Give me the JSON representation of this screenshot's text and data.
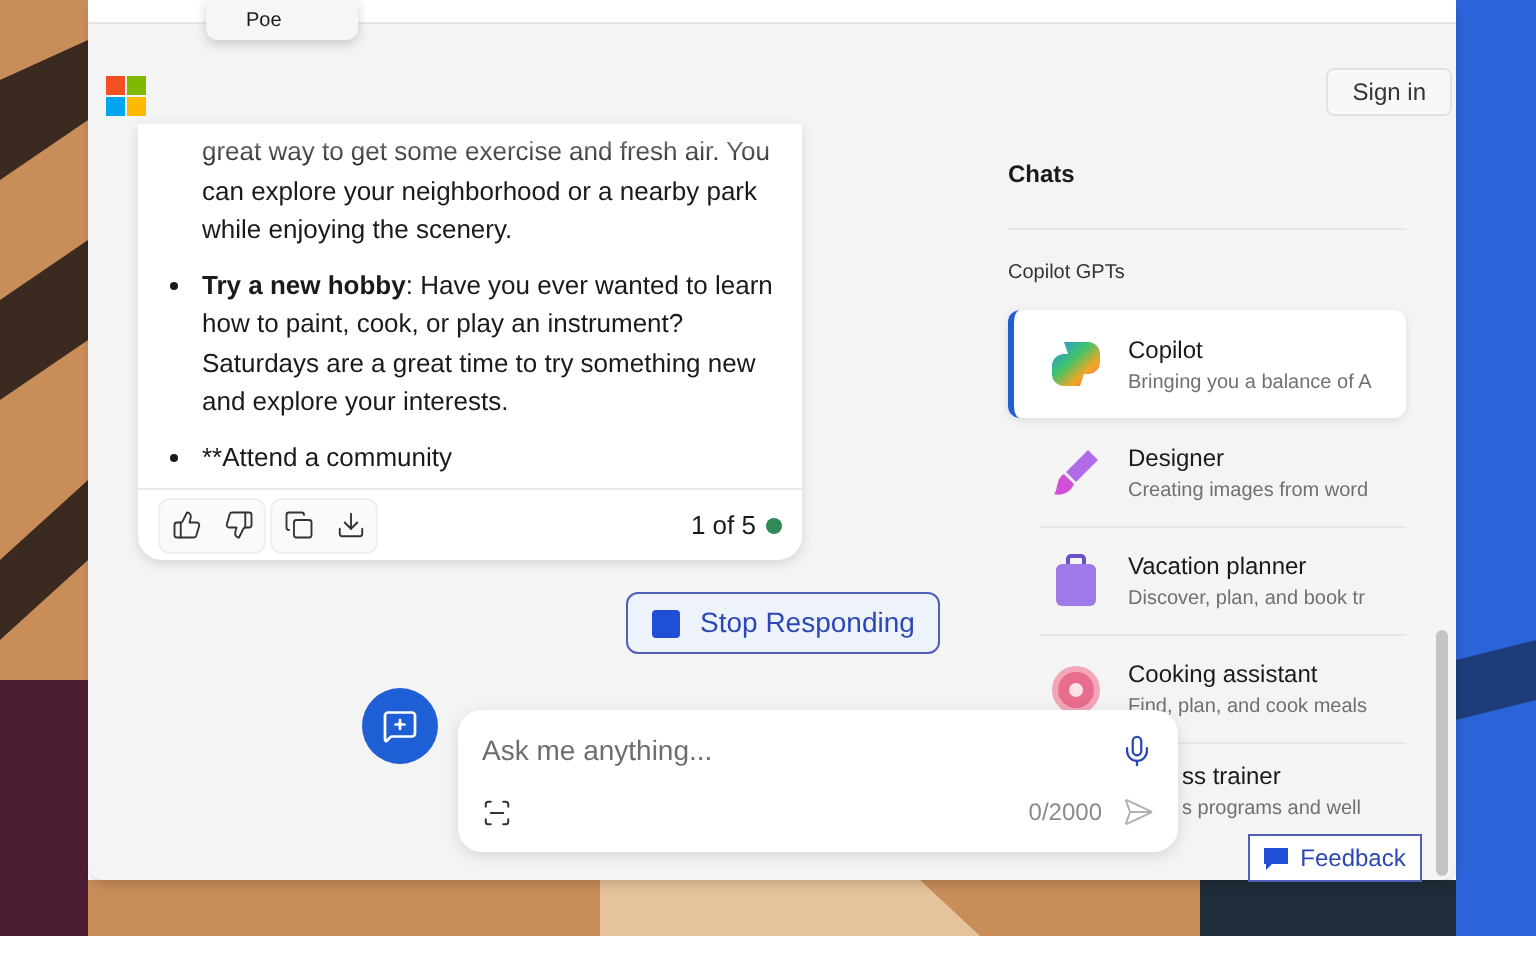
{
  "menu_popup": {
    "items": [
      "Poe"
    ]
  },
  "sign_in": "Sign in",
  "message": {
    "paragraphs": [
      {
        "kind": "continuation",
        "text": "great way to get some exercise and fresh air. You can explore your neighborhood or a nearby park while enjoying the scenery."
      },
      {
        "kind": "bullet",
        "bold": "Try a new hobby",
        "text": ": Have you ever wanted to learn how to paint, cook, or play an instrument? Saturdays are a great time to try something new and explore your interests."
      },
      {
        "kind": "bullet",
        "text": "**Attend a community"
      }
    ],
    "counter": "1 of 5"
  },
  "stop_button": "Stop Responding",
  "input": {
    "placeholder": "Ask me anything...",
    "char_count": "0/2000"
  },
  "sidebar": {
    "title": "Chats",
    "section": "Copilot GPTs",
    "items": [
      {
        "kind": "full",
        "title": "Copilot",
        "description": "Bringing you a balance of A",
        "selected": true
      },
      {
        "kind": "full",
        "title": "Designer",
        "description": "Creating images from word",
        "selected": false
      },
      {
        "kind": "full",
        "title": "Vacation planner",
        "description": "Discover, plan, and book tr",
        "selected": false
      },
      {
        "kind": "full",
        "title": "Cooking assistant",
        "description": "Find, plan, and cook meals",
        "selected": false
      },
      {
        "kind": "cut",
        "title": "ss trainer",
        "description": "s programs and well",
        "selected": false
      }
    ]
  },
  "feedback_button": "Feedback"
}
